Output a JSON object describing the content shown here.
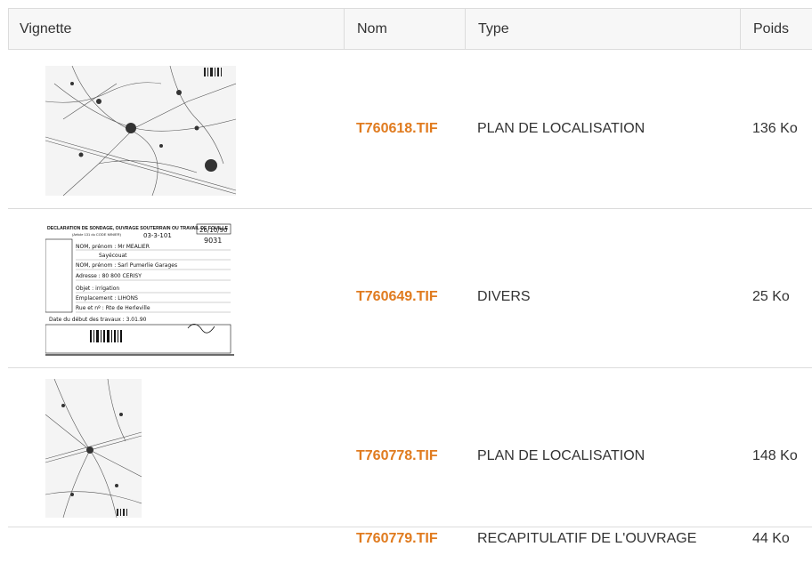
{
  "table": {
    "headers": {
      "vignette": "Vignette",
      "nom": "Nom",
      "type": "Type",
      "poids": "Poids"
    },
    "rows": [
      {
        "name": "T760618.TIF",
        "type": "PLAN DE LOCALISATION",
        "size": "136 Ko",
        "thumbnail": "map-thumbnail"
      },
      {
        "name": "T760649.TIF",
        "type": "DIVERS",
        "size": "25 Ko",
        "thumbnail": "form-thumbnail"
      },
      {
        "name": "T760778.TIF",
        "type": "PLAN DE LOCALISATION",
        "size": "148 Ko",
        "thumbnail": "map-thumbnail"
      },
      {
        "name": "T760779.TIF",
        "type": "RECAPITULATIF DE L'OUVRAGE",
        "size": "44 Ko",
        "thumbnail": "document-thumbnail"
      }
    ]
  },
  "form_thumbnail": {
    "title": "DECLARATION DE SONDAGE, OUVRAGE SOUTERRAIN OU TRAVAIL DE FOUILLE",
    "subtitle": "(Article 131 du CODE MINIER)",
    "ref": "03-3-101",
    "stamp_date": "26/10/90",
    "number": "9031",
    "lines": [
      "NOM, prénom : Mr MEALIER",
      "Sayécouat",
      "NOM, prénom : Sarl Pumerlie Garages",
      "Adresse : 80 800 CERISY",
      "Objet : irrigation",
      "Emplacement : LIHONS",
      "Rue et nº : Rte de Herleville",
      "Date du début des travaux : 3.01.90"
    ]
  },
  "colors": {
    "link": "#e07b1f",
    "header_bg": "#f7f7f7",
    "border": "#dcdcdc",
    "text": "#333333"
  }
}
